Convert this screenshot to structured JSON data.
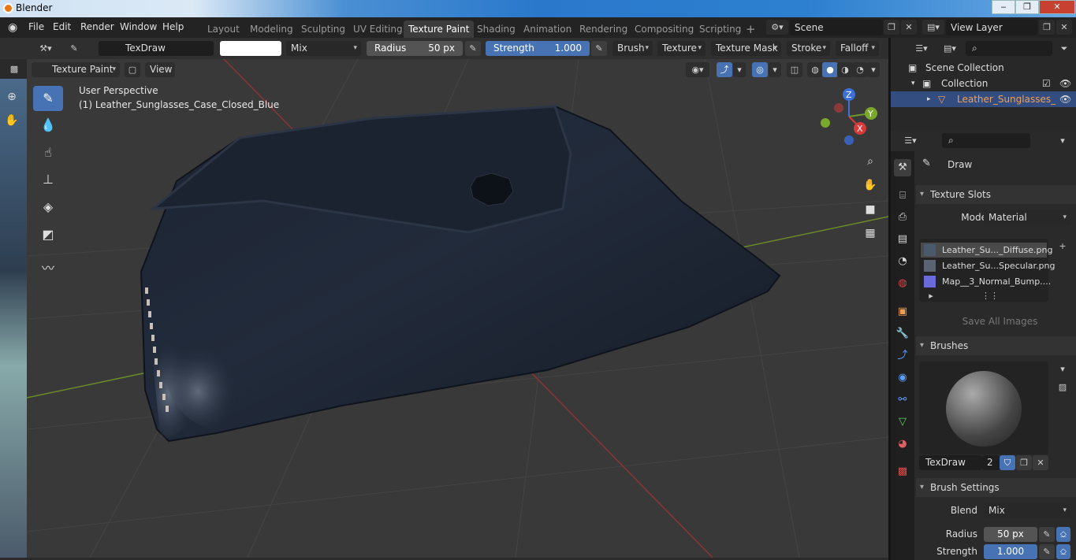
{
  "window": {
    "title": "Blender",
    "min": "‒",
    "max": "❐",
    "close": "✕"
  },
  "menu": [
    "File",
    "Edit",
    "Render",
    "Window",
    "Help"
  ],
  "workspaces": [
    "Layout",
    "Modeling",
    "Sculpting",
    "UV Editing",
    "Texture Paint",
    "Shading",
    "Animation",
    "Rendering",
    "Compositing",
    "Scripting"
  ],
  "active_workspace": "Texture Paint",
  "add_tab": "+",
  "scene": {
    "name": "Scene",
    "view_layer": "View Layer"
  },
  "tool_header": {
    "brush_name": "TexDraw",
    "blend": "Mix",
    "radius_label": "Radius",
    "radius_value": "50 px",
    "strength_label": "Strength",
    "strength_value": "1.000",
    "brush_menu": "Brush",
    "texture_menu": "Texture",
    "texture_mask_menu": "Texture Mask",
    "stroke_menu": "Stroke",
    "falloff_menu": "Falloff"
  },
  "viewport_header": {
    "mode": "Texture Paint",
    "view": "View"
  },
  "viewport": {
    "perspective": "User Perspective",
    "object_label": "(1) Leather_Sunglasses_Case_Closed_Blue",
    "gizmo": {
      "z": "Z",
      "y": "Y",
      "x": "X"
    }
  },
  "outliner": {
    "root": "Scene Collection",
    "collection": "Collection",
    "object": "Leather_Sunglasses_"
  },
  "properties": {
    "active_tool": "Draw",
    "texture_slots": {
      "title": "Texture Slots",
      "mode_label": "Mode",
      "mode_value": "Material",
      "slots": [
        "Leather_Su..._Diffuse.png",
        "Leather_Su...Specular.png",
        "Map__3_Normal_Bump...."
      ],
      "save_all": "Save All Images"
    },
    "brushes": {
      "title": "Brushes",
      "brush_name": "TexDraw",
      "users": "2"
    },
    "brush_settings": {
      "title": "Brush Settings",
      "blend_label": "Blend",
      "blend_value": "Mix",
      "radius_label": "Radius",
      "radius_value": "50 px",
      "strength_label": "Strength",
      "strength_value": "1.000"
    }
  },
  "colors": {
    "accent": "#4772b3",
    "active_object": "#f0a054",
    "bg": "#393939"
  }
}
